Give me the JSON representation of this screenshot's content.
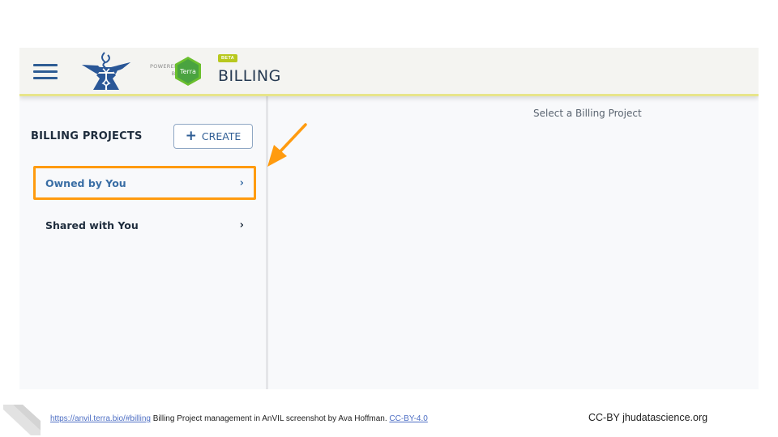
{
  "header": {
    "menu_icon": "hamburger-icon",
    "logo_icon": "anvil-logo-icon",
    "powered_by_line1": "POWERED",
    "powered_by_line2": "BY",
    "terra_label": "Terra",
    "beta_badge": "BETA",
    "app_title": "BILLING"
  },
  "sidebar": {
    "title": "BILLING PROJECTS",
    "create_button": {
      "icon": "plus-icon",
      "label": "CREATE"
    },
    "items": [
      {
        "label": "Owned by You",
        "chevron": "›",
        "highlighted": true
      },
      {
        "label": "Shared with You",
        "chevron": "›",
        "highlighted": false
      }
    ]
  },
  "main": {
    "placeholder": "Select a Billing Project"
  },
  "annotation": {
    "arrow_color": "#ff9b0f",
    "highlight_color": "#ff9b0f"
  },
  "footer": {
    "link_url_text": "https://anvil.terra.bio/#billing",
    "caption": " Billing Project management in AnVIL screenshot by Ava Hoffman. ",
    "license_link": "CC-BY-4.0",
    "credit": "CC-BY  jhudatascience.org"
  },
  "colors": {
    "brand_blue": "#2f5d94",
    "header_accent": "#e7e58a",
    "terra_green": "#6abf2e",
    "beta_green": "#b8c81e"
  }
}
